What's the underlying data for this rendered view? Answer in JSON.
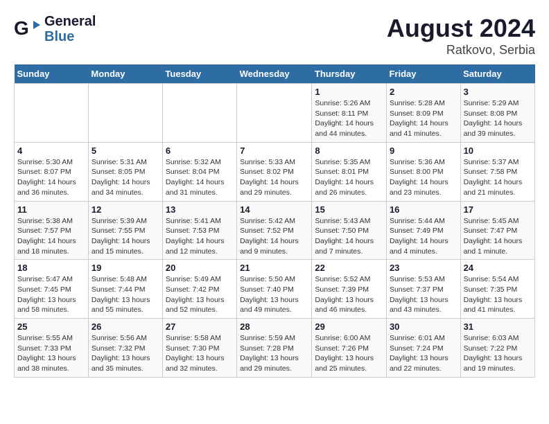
{
  "logo": {
    "general": "General",
    "blue": "Blue"
  },
  "title": {
    "month_year": "August 2024",
    "location": "Ratkovo, Serbia"
  },
  "header_days": [
    "Sunday",
    "Monday",
    "Tuesday",
    "Wednesday",
    "Thursday",
    "Friday",
    "Saturday"
  ],
  "weeks": [
    {
      "days": [
        {
          "num": "",
          "info": ""
        },
        {
          "num": "",
          "info": ""
        },
        {
          "num": "",
          "info": ""
        },
        {
          "num": "",
          "info": ""
        },
        {
          "num": "1",
          "info": "Sunrise: 5:26 AM\nSunset: 8:11 PM\nDaylight: 14 hours\nand 44 minutes."
        },
        {
          "num": "2",
          "info": "Sunrise: 5:28 AM\nSunset: 8:09 PM\nDaylight: 14 hours\nand 41 minutes."
        },
        {
          "num": "3",
          "info": "Sunrise: 5:29 AM\nSunset: 8:08 PM\nDaylight: 14 hours\nand 39 minutes."
        }
      ]
    },
    {
      "days": [
        {
          "num": "4",
          "info": "Sunrise: 5:30 AM\nSunset: 8:07 PM\nDaylight: 14 hours\nand 36 minutes."
        },
        {
          "num": "5",
          "info": "Sunrise: 5:31 AM\nSunset: 8:05 PM\nDaylight: 14 hours\nand 34 minutes."
        },
        {
          "num": "6",
          "info": "Sunrise: 5:32 AM\nSunset: 8:04 PM\nDaylight: 14 hours\nand 31 minutes."
        },
        {
          "num": "7",
          "info": "Sunrise: 5:33 AM\nSunset: 8:02 PM\nDaylight: 14 hours\nand 29 minutes."
        },
        {
          "num": "8",
          "info": "Sunrise: 5:35 AM\nSunset: 8:01 PM\nDaylight: 14 hours\nand 26 minutes."
        },
        {
          "num": "9",
          "info": "Sunrise: 5:36 AM\nSunset: 8:00 PM\nDaylight: 14 hours\nand 23 minutes."
        },
        {
          "num": "10",
          "info": "Sunrise: 5:37 AM\nSunset: 7:58 PM\nDaylight: 14 hours\nand 21 minutes."
        }
      ]
    },
    {
      "days": [
        {
          "num": "11",
          "info": "Sunrise: 5:38 AM\nSunset: 7:57 PM\nDaylight: 14 hours\nand 18 minutes."
        },
        {
          "num": "12",
          "info": "Sunrise: 5:39 AM\nSunset: 7:55 PM\nDaylight: 14 hours\nand 15 minutes."
        },
        {
          "num": "13",
          "info": "Sunrise: 5:41 AM\nSunset: 7:53 PM\nDaylight: 14 hours\nand 12 minutes."
        },
        {
          "num": "14",
          "info": "Sunrise: 5:42 AM\nSunset: 7:52 PM\nDaylight: 14 hours\nand 9 minutes."
        },
        {
          "num": "15",
          "info": "Sunrise: 5:43 AM\nSunset: 7:50 PM\nDaylight: 14 hours\nand 7 minutes."
        },
        {
          "num": "16",
          "info": "Sunrise: 5:44 AM\nSunset: 7:49 PM\nDaylight: 14 hours\nand 4 minutes."
        },
        {
          "num": "17",
          "info": "Sunrise: 5:45 AM\nSunset: 7:47 PM\nDaylight: 14 hours\nand 1 minute."
        }
      ]
    },
    {
      "days": [
        {
          "num": "18",
          "info": "Sunrise: 5:47 AM\nSunset: 7:45 PM\nDaylight: 13 hours\nand 58 minutes."
        },
        {
          "num": "19",
          "info": "Sunrise: 5:48 AM\nSunset: 7:44 PM\nDaylight: 13 hours\nand 55 minutes."
        },
        {
          "num": "20",
          "info": "Sunrise: 5:49 AM\nSunset: 7:42 PM\nDaylight: 13 hours\nand 52 minutes."
        },
        {
          "num": "21",
          "info": "Sunrise: 5:50 AM\nSunset: 7:40 PM\nDaylight: 13 hours\nand 49 minutes."
        },
        {
          "num": "22",
          "info": "Sunrise: 5:52 AM\nSunset: 7:39 PM\nDaylight: 13 hours\nand 46 minutes."
        },
        {
          "num": "23",
          "info": "Sunrise: 5:53 AM\nSunset: 7:37 PM\nDaylight: 13 hours\nand 43 minutes."
        },
        {
          "num": "24",
          "info": "Sunrise: 5:54 AM\nSunset: 7:35 PM\nDaylight: 13 hours\nand 41 minutes."
        }
      ]
    },
    {
      "days": [
        {
          "num": "25",
          "info": "Sunrise: 5:55 AM\nSunset: 7:33 PM\nDaylight: 13 hours\nand 38 minutes."
        },
        {
          "num": "26",
          "info": "Sunrise: 5:56 AM\nSunset: 7:32 PM\nDaylight: 13 hours\nand 35 minutes."
        },
        {
          "num": "27",
          "info": "Sunrise: 5:58 AM\nSunset: 7:30 PM\nDaylight: 13 hours\nand 32 minutes."
        },
        {
          "num": "28",
          "info": "Sunrise: 5:59 AM\nSunset: 7:28 PM\nDaylight: 13 hours\nand 29 minutes."
        },
        {
          "num": "29",
          "info": "Sunrise: 6:00 AM\nSunset: 7:26 PM\nDaylight: 13 hours\nand 25 minutes."
        },
        {
          "num": "30",
          "info": "Sunrise: 6:01 AM\nSunset: 7:24 PM\nDaylight: 13 hours\nand 22 minutes."
        },
        {
          "num": "31",
          "info": "Sunrise: 6:03 AM\nSunset: 7:22 PM\nDaylight: 13 hours\nand 19 minutes."
        }
      ]
    }
  ]
}
